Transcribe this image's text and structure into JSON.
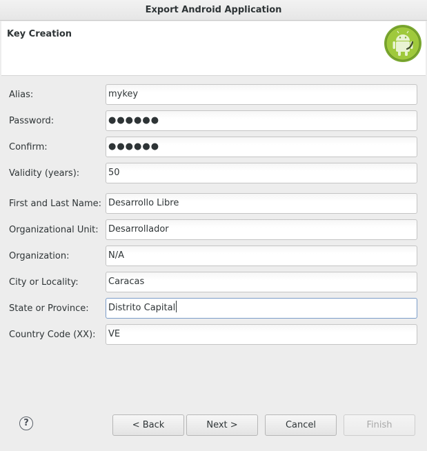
{
  "window": {
    "title": "Export Android Application"
  },
  "header": {
    "title": "Key Creation",
    "logo_icon": "android-robot-icon"
  },
  "form": {
    "alias": {
      "label": "Alias:",
      "value": "mykey"
    },
    "password": {
      "label": "Password:",
      "value": "●●●●●●"
    },
    "confirm": {
      "label": "Confirm:",
      "value": "●●●●●●"
    },
    "validity": {
      "label": "Validity (years):",
      "value": "50"
    },
    "name": {
      "label": "First and Last Name:",
      "value": "Desarrollo Libre"
    },
    "unit": {
      "label": "Organizational Unit:",
      "value": "Desarrollador"
    },
    "org": {
      "label": "Organization:",
      "value": "N/A"
    },
    "city": {
      "label": "City or Locality:",
      "value": "Caracas"
    },
    "state": {
      "label": "State or Province:",
      "value": "Distrito Capital"
    },
    "country": {
      "label": "Country Code (XX):",
      "value": "VE"
    }
  },
  "footer": {
    "help_glyph": "?",
    "back": "< Back",
    "next": "Next >",
    "cancel": "Cancel",
    "finish": "Finish"
  },
  "colors": {
    "android_green": "#9fc93c",
    "focus_border": "#7a9cc8"
  }
}
